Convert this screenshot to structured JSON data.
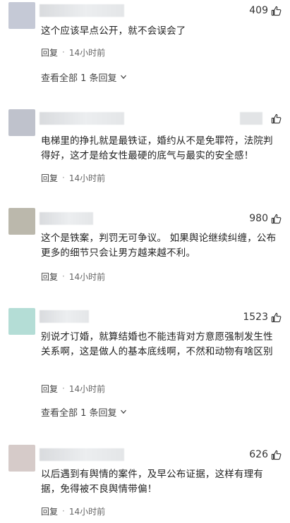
{
  "comments": [
    {
      "avatar_color": "#c5c9d6",
      "likes": "409",
      "text": "这个应该早点公开，就不会误会了",
      "reply_label": "回复",
      "separator": "·",
      "time": "14小时前",
      "view_all": "查看全部 1 条回复"
    },
    {
      "avatar_color": "#bfc2cc",
      "likes": "",
      "text": "电梯里的挣扎就是最铁证，婚约从不是免罪符，法院判得好，这才是给女性最硬的底气与最实的安全感！",
      "reply_label": "回复",
      "separator": "·",
      "time": "14小时前"
    },
    {
      "avatar_color": "#bbb8ac",
      "likes": "980",
      "text": "这个是铁案，判罚无可争议。 如果舆论继续纠缠，公布更多的细节只会让男方越来越不利。",
      "reply_label": "回复",
      "separator": "·",
      "time": "14小时前"
    },
    {
      "avatar_color": "#b4ddd6",
      "likes": "1523",
      "text": "别说才订婚，就算结婚也不能违背对方意愿强制发生性关系啊，这是做人的基本底线啊，不然和动物有啥区别",
      "reply_label": "回复",
      "separator": "·",
      "time": "14小时前",
      "view_all": "查看全部 1 条回复"
    },
    {
      "avatar_color": "#d6cbc9",
      "likes": "626",
      "text": "以后遇到有舆情的案件，及早公布证据，这样有理有据，免得被不良舆情带偏！",
      "reply_label": "回复",
      "separator": "·",
      "time": "14小时前"
    }
  ],
  "icons": {
    "like": "thumbs-up-icon",
    "expand": "chevron-down-icon"
  }
}
